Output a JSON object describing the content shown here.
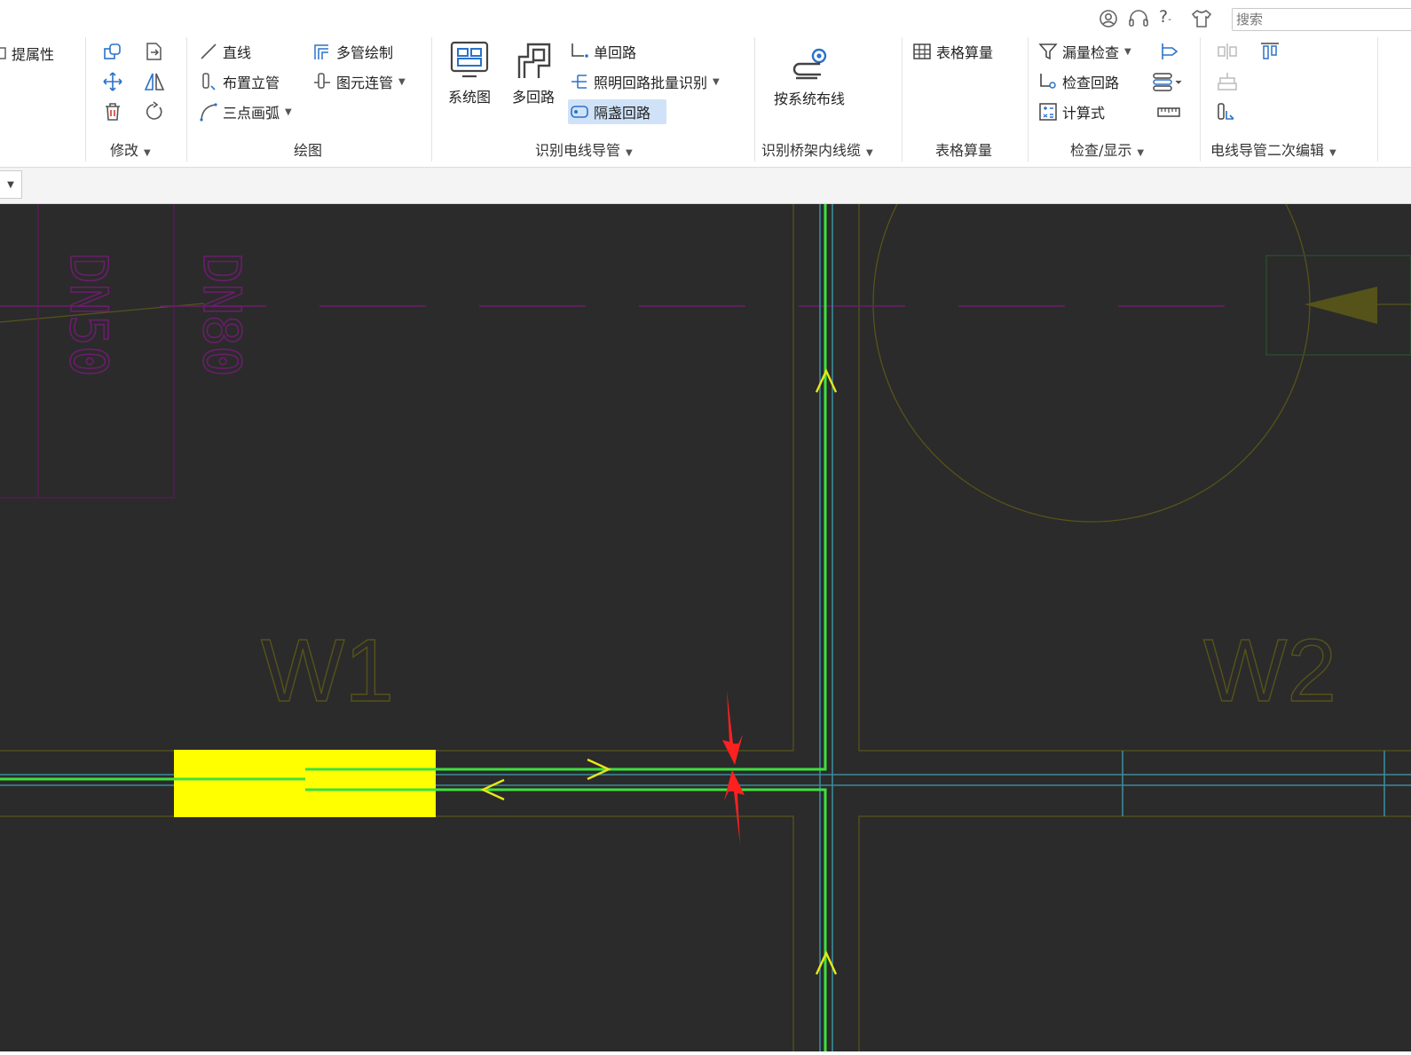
{
  "header": {
    "search_placeholder": "搜索",
    "icons": [
      "user-icon",
      "headset-icon",
      "help-icon",
      "shirt-icon"
    ],
    "help_label": "?"
  },
  "ribbon": {
    "groups": {
      "properties": {
        "extract_label": "提属性"
      },
      "modify": {
        "label": "修改"
      },
      "draw": {
        "label": "绘图",
        "line": "直线",
        "riser": "布置立管",
        "arc3": "三点画弧",
        "multi_pipe": "多管绘制",
        "connect": "图元连管"
      },
      "identify": {
        "label": "识别电线导管",
        "system_diagram": "系统图",
        "multi_circuit": "多回路",
        "single_circuit": "单回路",
        "lighting_batch": "照明回路批量识别",
        "isolate_circuit": "隔盏回路"
      },
      "tray": {
        "label": "识别桥架内线缆",
        "by_system": "按系统布线"
      },
      "table": {
        "label": "表格算量",
        "button": "表格算量"
      },
      "check": {
        "label": "检查/显示",
        "missing": "漏量检查",
        "circuit": "检查回路",
        "formula": "计算式"
      },
      "secondary": {
        "label": "电线导管二次编辑"
      }
    }
  },
  "canvas": {
    "bg_color": "#2b2b2b",
    "pipe_color": "#3ee03e",
    "highlight_color": "#ffff00",
    "arrow_color": "#ff2020",
    "labels": {
      "w1": "W1",
      "w2": "W2",
      "dn50": "DN50",
      "dn80": "DN80"
    }
  }
}
